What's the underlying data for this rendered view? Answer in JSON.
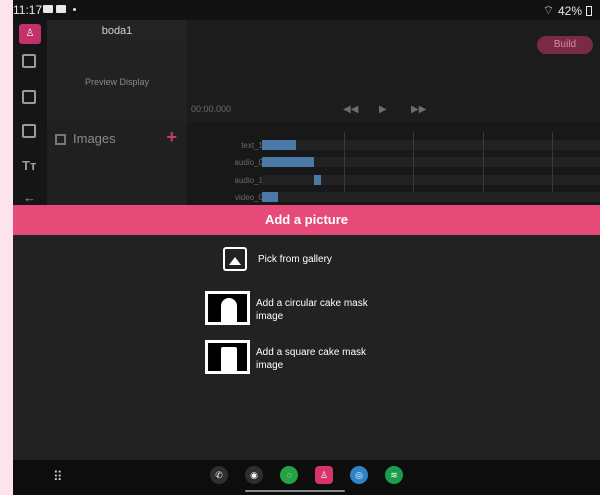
{
  "status_bar": {
    "time": "11:17",
    "battery": "42%"
  },
  "project": {
    "name": "boda1",
    "preview_label": "Preview Display",
    "assets_label": "Images"
  },
  "toolbar": {
    "build_label": "Build",
    "timecode": "00:00.000"
  },
  "timeline": {
    "tracks": [
      {
        "label": "text_1"
      },
      {
        "label": "audio_0"
      },
      {
        "label": "audio_1"
      },
      {
        "label": "video_0"
      }
    ]
  },
  "sheet": {
    "title": "Add a picture",
    "options": [
      {
        "label": "Pick from gallery",
        "icon": "image-icon"
      },
      {
        "label": "Add a circular cake mask image",
        "line1": "Add a circular cake mask",
        "line2": "image",
        "icon": "cake-mask-thumbnail"
      },
      {
        "label": "Add a square cake mask image",
        "line1": "Add a square cake mask",
        "line2": "image",
        "icon": "cake-mask-thumbnail"
      }
    ]
  },
  "dock": [
    "phone-app-icon",
    "maps-app-icon",
    "whatsapp-app-icon",
    "editor-app-icon",
    "messages-app-icon",
    "spotify-app-icon"
  ],
  "colors": {
    "accent": "#e64a79",
    "background": "#1c1c1c",
    "clip": "#4b7aa9"
  }
}
